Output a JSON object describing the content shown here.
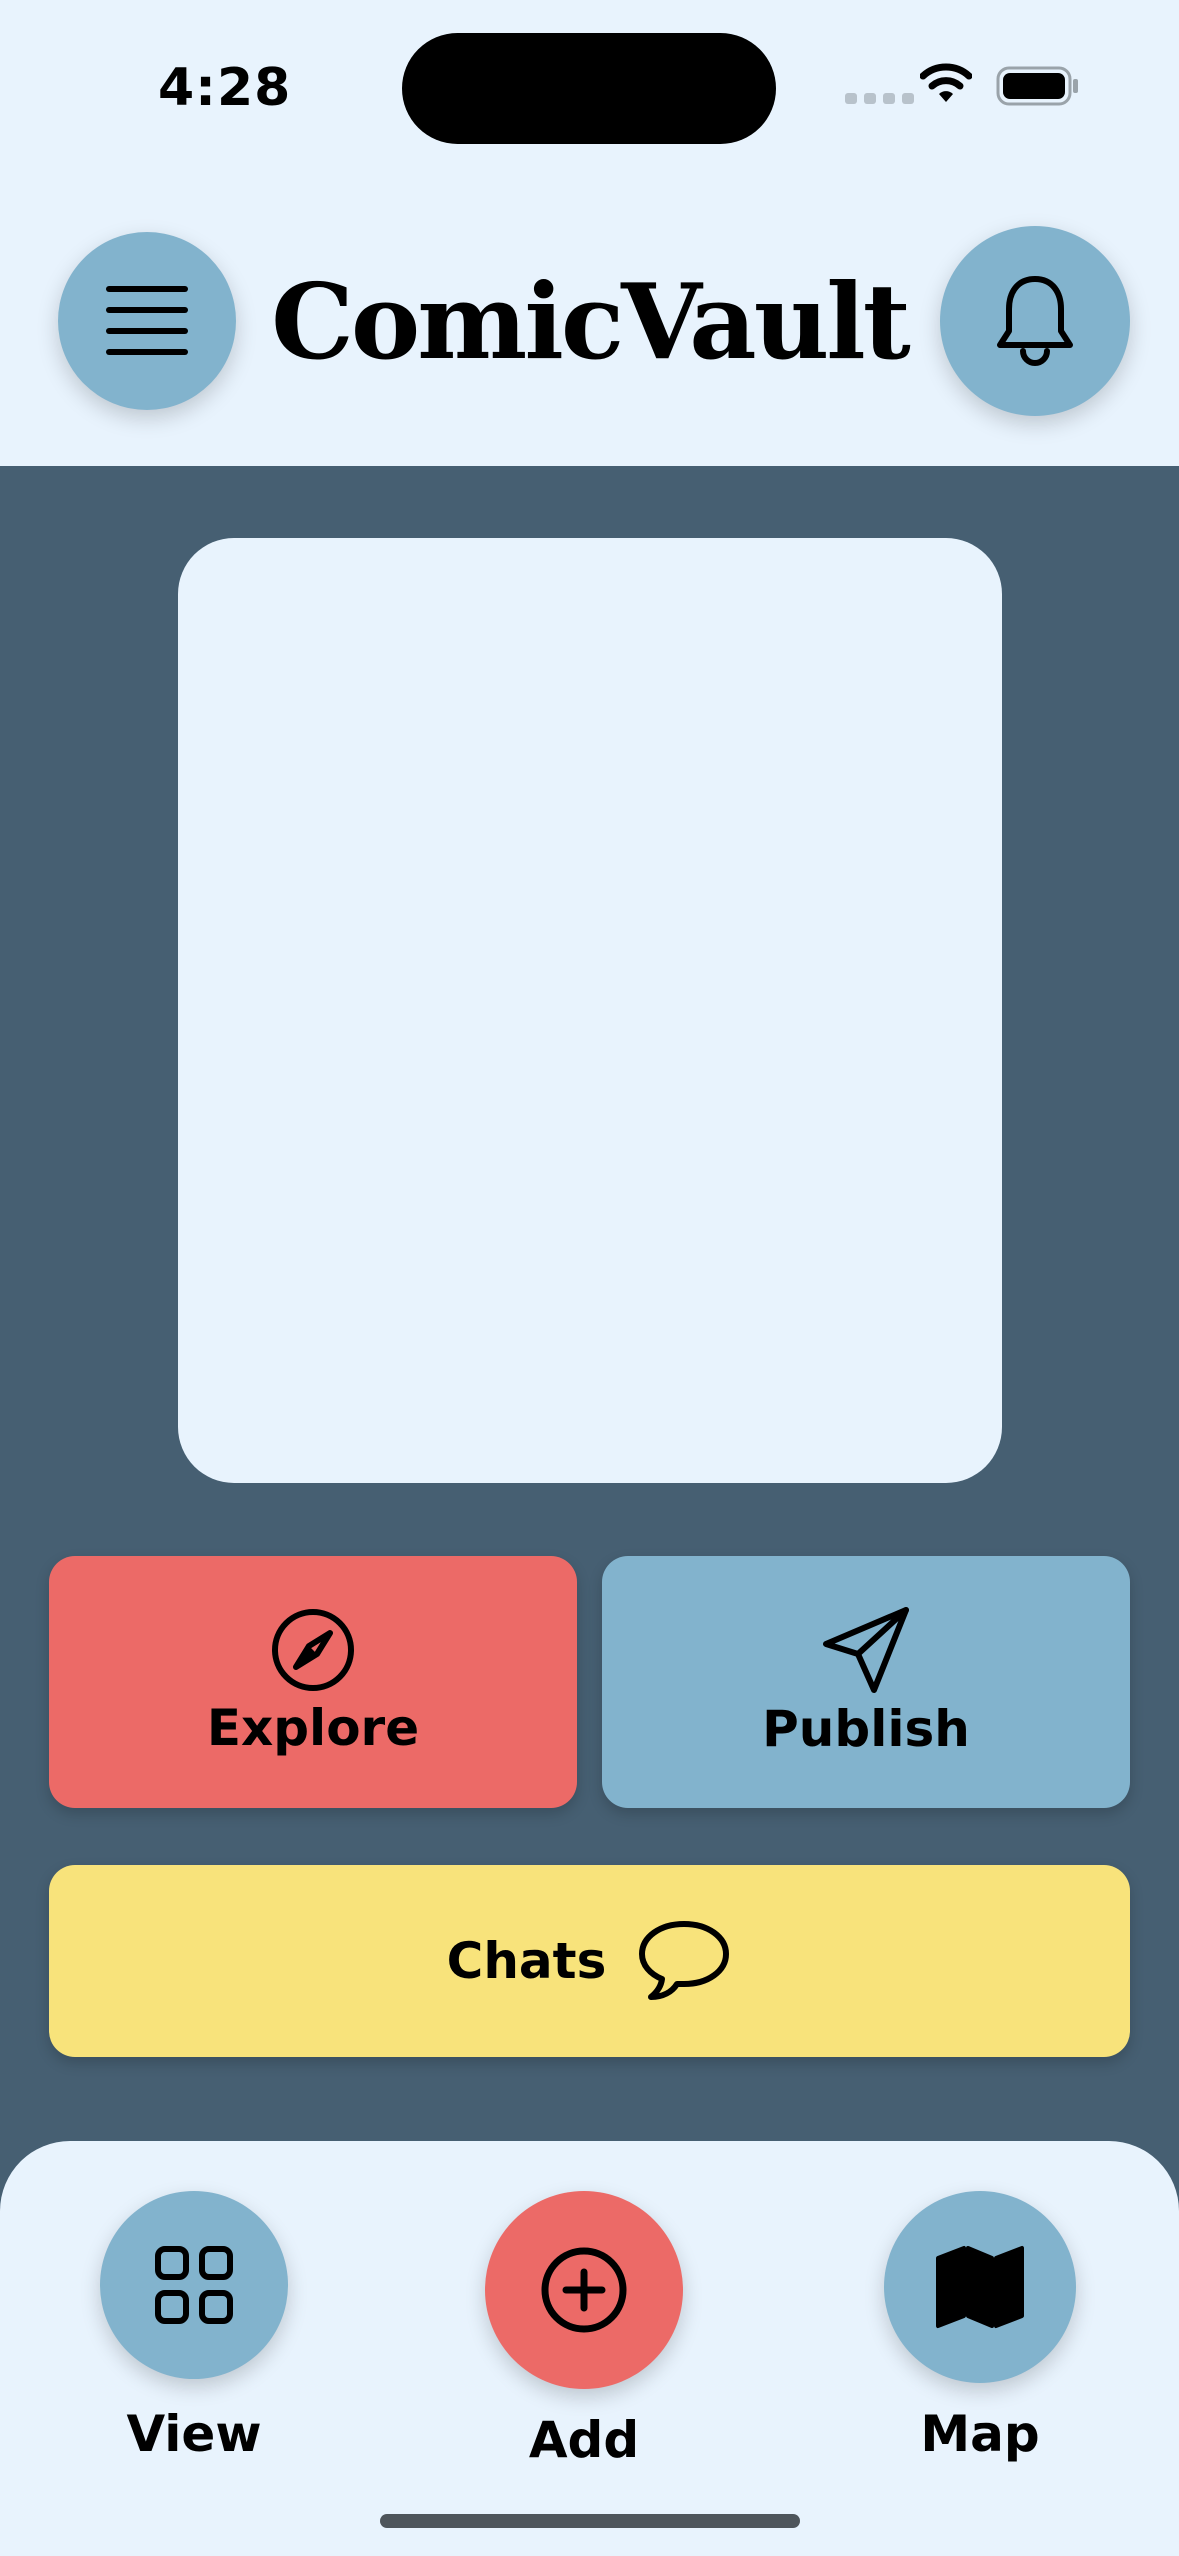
{
  "status_bar": {
    "time": "4:28"
  },
  "header": {
    "title": "ComicVault",
    "menu_icon": "hamburger-menu-icon",
    "notification_icon": "bell-icon"
  },
  "actions": {
    "explore": {
      "label": "Explore",
      "icon": "compass-icon",
      "color": "#ec6a67"
    },
    "publish": {
      "label": "Publish",
      "icon": "paper-plane-icon",
      "color": "#82b3cd"
    },
    "chats": {
      "label": "Chats",
      "icon": "speech-bubble-icon",
      "color": "#f8e37b"
    }
  },
  "bottom_nav": {
    "items": [
      {
        "label": "View",
        "icon": "grid-icon",
        "color": "#82b3cd"
      },
      {
        "label": "Add",
        "icon": "plus-circle-icon",
        "color": "#ec6a67"
      },
      {
        "label": "Map",
        "icon": "map-icon",
        "color": "#82b3cd"
      }
    ]
  },
  "colors": {
    "background": "#465f72",
    "surface": "#e8f3fd",
    "accent_blue": "#82b3cd",
    "accent_red": "#ec6a67",
    "accent_yellow": "#f8e37b"
  }
}
